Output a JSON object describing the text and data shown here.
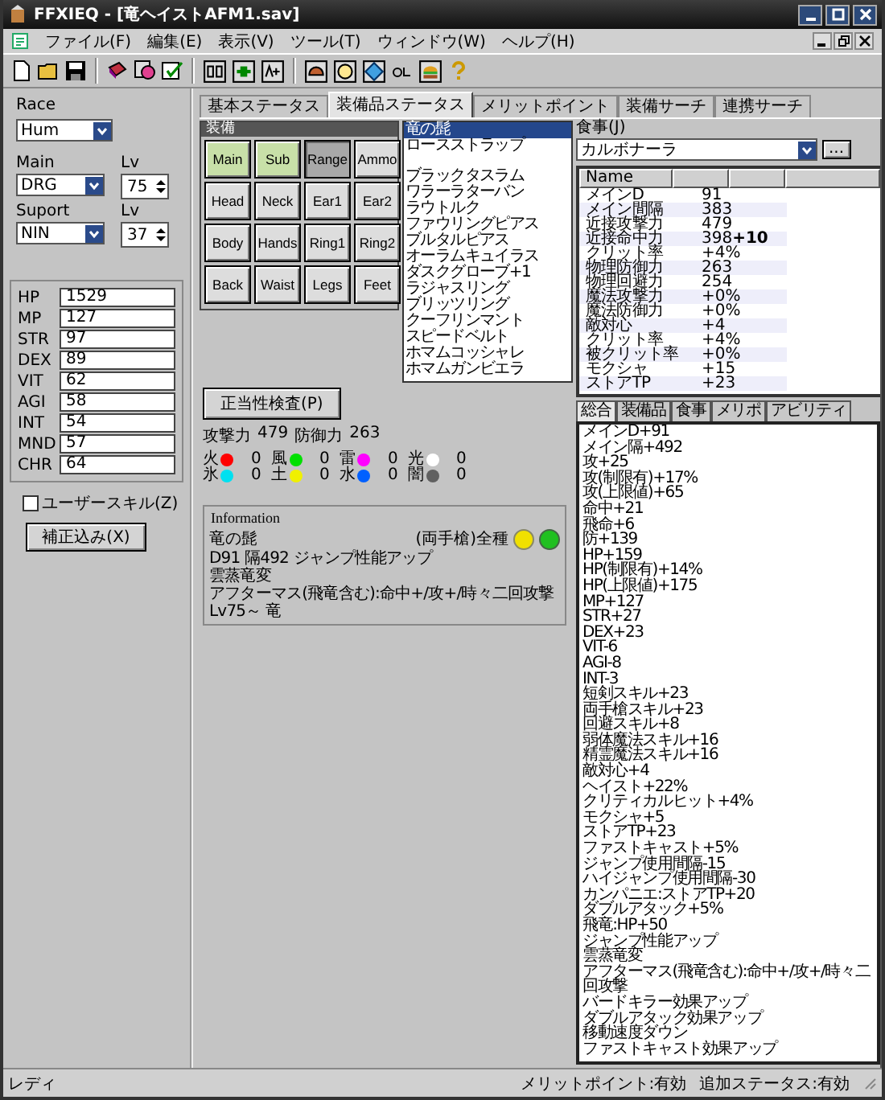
{
  "window": {
    "title": "FFXIEQ - [竜ヘイストAFM1.sav]"
  },
  "menu": [
    "ファイル(F)",
    "編集(E)",
    "表示(V)",
    "ツール(T)",
    "ウィンドウ(W)",
    "ヘルプ(H)"
  ],
  "character": {
    "race_label": "Race",
    "race": "Hum",
    "main_label": "Main",
    "main": "DRG",
    "main_lv_label": "Lv",
    "main_lv": "75",
    "support_label": "Suport",
    "support": "NIN",
    "support_lv_label": "Lv",
    "support_lv": "37"
  },
  "stats": [
    {
      "name": "HP",
      "value": "1529"
    },
    {
      "name": "MP",
      "value": "127"
    },
    {
      "name": "STR",
      "value": "97"
    },
    {
      "name": "DEX",
      "value": "89"
    },
    {
      "name": "VIT",
      "value": "62"
    },
    {
      "name": "AGI",
      "value": "58"
    },
    {
      "name": "INT",
      "value": "54"
    },
    {
      "name": "MND",
      "value": "57"
    },
    {
      "name": "CHR",
      "value": "64"
    }
  ],
  "user_skill": {
    "label": "ユーザースキル(Z)",
    "checked": false
  },
  "adjusted_button": "補正込み(X)",
  "tabs": [
    {
      "label": "基本ステータス",
      "selected": false
    },
    {
      "label": "装備品ステータス",
      "selected": true
    },
    {
      "label": "メリットポイント",
      "selected": false
    },
    {
      "label": "装備サーチ",
      "selected": false
    },
    {
      "label": "連携サーチ",
      "selected": false
    }
  ],
  "equipment": {
    "title": "装備",
    "slots": [
      {
        "label": "Main",
        "highlighted": true,
        "pressed": false
      },
      {
        "label": "Sub",
        "highlighted": true,
        "pressed": false
      },
      {
        "label": "Range",
        "highlighted": false,
        "pressed": true
      },
      {
        "label": "Ammo",
        "highlighted": false,
        "pressed": false
      },
      {
        "label": "Head",
        "highlighted": false,
        "pressed": false
      },
      {
        "label": "Neck",
        "highlighted": false,
        "pressed": false
      },
      {
        "label": "Ear1",
        "highlighted": false,
        "pressed": false
      },
      {
        "label": "Ear2",
        "highlighted": false,
        "pressed": false
      },
      {
        "label": "Body",
        "highlighted": false,
        "pressed": false
      },
      {
        "label": "Hands",
        "highlighted": false,
        "pressed": false
      },
      {
        "label": "Ring1",
        "highlighted": false,
        "pressed": false
      },
      {
        "label": "Ring2",
        "highlighted": false,
        "pressed": false
      },
      {
        "label": "Back",
        "highlighted": false,
        "pressed": false
      },
      {
        "label": "Waist",
        "highlighted": false,
        "pressed": false
      },
      {
        "label": "Legs",
        "highlighted": false,
        "pressed": false
      },
      {
        "label": "Feet",
        "highlighted": false,
        "pressed": false
      }
    ]
  },
  "item_groups": [
    {
      "items": [
        {
          "name": "竜の髭",
          "selected": true
        },
        {
          "name": "ロースストラップ",
          "selected": false
        }
      ]
    },
    {
      "items": [
        {
          "name": "ブラックタスラム",
          "selected": false
        },
        {
          "name": "ワラーラターバン",
          "selected": false
        },
        {
          "name": "ラウトルク",
          "selected": false
        },
        {
          "name": "ファウリングピアス",
          "selected": false
        },
        {
          "name": "ブルタルピアス",
          "selected": false
        },
        {
          "name": "オーラムキュイラス",
          "selected": false
        },
        {
          "name": "ダスクグローブ+1",
          "selected": false
        },
        {
          "name": "ラジャスリング",
          "selected": false
        },
        {
          "name": "ブリッツリング",
          "selected": false
        },
        {
          "name": "クーフリンマント",
          "selected": false
        },
        {
          "name": "スピードベルト",
          "selected": false
        },
        {
          "name": "ホマムコッシャレ",
          "selected": false
        },
        {
          "name": "ホマムガンビエラ",
          "selected": false
        }
      ]
    }
  ],
  "check_button": "正当性検査(P)",
  "attack": {
    "label": "攻撃力",
    "value": "479"
  },
  "defense": {
    "label": "防御力",
    "value": "263"
  },
  "elements": [
    {
      "name": "火",
      "color": "#ff0000",
      "value": "0"
    },
    {
      "name": "風",
      "color": "#00e000",
      "value": "0"
    },
    {
      "name": "雷",
      "color": "#ff00ff",
      "value": "0"
    },
    {
      "name": "光",
      "color": "#ffffff",
      "value": "0"
    },
    {
      "name": "氷",
      "color": "#00e0f0",
      "value": "0"
    },
    {
      "name": "土",
      "color": "#f0f000",
      "value": "0"
    },
    {
      "name": "水",
      "color": "#0060ff",
      "value": "0"
    },
    {
      "name": "闇",
      "color": "#606060",
      "value": "0"
    }
  ],
  "information": {
    "title": "Information",
    "name": "竜の髭",
    "category": "(両手槍)全種",
    "lines": [
      "D91 隔492 ジャンプ性能アップ",
      "雲蒸竜変",
      "アフターマス(飛竜含む):命中+/攻+/時々二回攻撃",
      "Lv75～ 竜"
    ]
  },
  "food": {
    "label": "食事(J)",
    "value": "カルボナーラ",
    "button": "..."
  },
  "stat_table": {
    "columns": [
      "Name"
    ],
    "rows": [
      {
        "name": "メインD",
        "value": "91"
      },
      {
        "name": "メイン間隔",
        "value": "383"
      },
      {
        "name": "近接攻撃力",
        "value": "479"
      },
      {
        "name": "近接命中力",
        "value": "398",
        "bonus": "+10"
      },
      {
        "name": "クリット率",
        "value": "+4%"
      },
      {
        "name": "物理防御力",
        "value": "263"
      },
      {
        "name": "物理回避力",
        "value": "254"
      },
      {
        "name": "魔法攻撃力",
        "value": "+0%"
      },
      {
        "name": "魔法防御力",
        "value": "+0%"
      },
      {
        "name": "敵対心",
        "value": "+4"
      },
      {
        "name": "クリット率",
        "value": "+4%"
      },
      {
        "name": "被クリット率",
        "value": "+0%"
      },
      {
        "name": "モクシャ",
        "value": "+15"
      },
      {
        "name": "ストアTP",
        "value": "+23"
      }
    ]
  },
  "summary_tabs": [
    {
      "label": "総合",
      "selected": true
    },
    {
      "label": "装備品",
      "selected": false
    },
    {
      "label": "食事",
      "selected": false
    },
    {
      "label": "メリポ",
      "selected": false
    },
    {
      "label": "アビリティ",
      "selected": false
    }
  ],
  "summary_lines": [
    "メインD+91",
    "メイン隔+492",
    "攻+25",
    "攻(制限有)+17%",
    "攻(上限値)+65",
    "命中+21",
    "飛命+6",
    "防+139",
    "HP+159",
    "HP(制限有)+14%",
    "HP(上限値)+175",
    "MP+127",
    "STR+27",
    "DEX+23",
    "VIT-6",
    "AGI-8",
    "INT-3",
    "短剣スキル+23",
    "両手槍スキル+23",
    "回避スキル+8",
    "弱体魔法スキル+16",
    "精霊魔法スキル+16",
    "敵対心+4",
    "ヘイスト+22%",
    "クリティカルヒット+4%",
    "モクシャ+5",
    "ストアTP+23",
    "ファストキャスト+5%",
    "ジャンプ使用間隔-15",
    "ハイジャンプ使用間隔-30",
    "カンパニエ:ストアTP+20",
    "ダブルアタック+5%",
    "飛竜:HP+50",
    "ジャンプ性能アップ",
    "雲蒸竜変",
    "アフターマス(飛竜含む):命中+/攻+/時々二回攻撃",
    "バードキラー効果アップ",
    "ダブルアタック効果アップ",
    "移動速度ダウン",
    "ファストキャスト効果アップ"
  ],
  "status_bar": {
    "left": "レディ",
    "right": [
      "メリットポイント:有効",
      "追加ステータス:有効"
    ]
  }
}
